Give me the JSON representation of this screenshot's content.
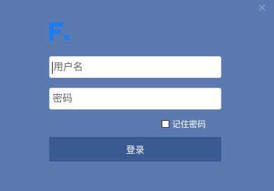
{
  "window": {
    "close_icon": "close-icon"
  },
  "logo": {
    "mark_icon": "brand-logo-mark",
    "brand_text": "",
    "sub_text": ""
  },
  "form": {
    "username_placeholder": "用户名",
    "username_value": "",
    "password_placeholder": "密码",
    "password_value": "",
    "remember_label": "记住密码",
    "remember_checked": false,
    "login_label": "登录"
  },
  "colors": {
    "background": "#5a7ab0",
    "button": "#3a5a94",
    "brand_blue": "#1e7cf0",
    "text_light": "#ffffff"
  }
}
